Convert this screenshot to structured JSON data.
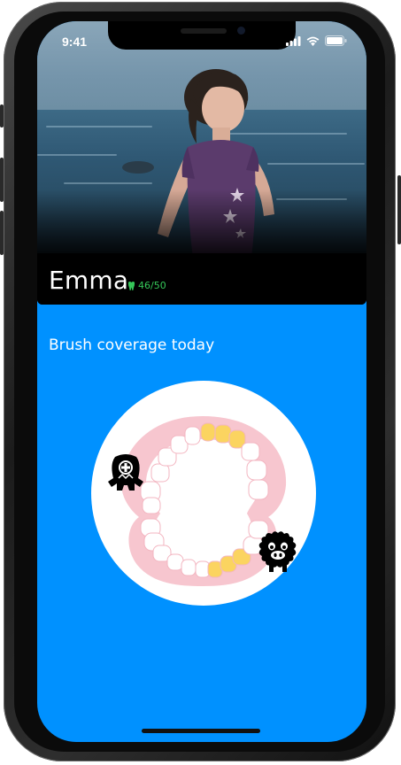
{
  "status_bar": {
    "time": "9:41"
  },
  "profile": {
    "name": "Emma",
    "score": "46/50",
    "score_color": "#35c759"
  },
  "coverage": {
    "title": "Brush coverage today",
    "brushed_color": "#fbd460",
    "unbrushed_color": "#ffffff",
    "gum_color": "#f7c6cf"
  },
  "colors": {
    "screen_background": "#0091ff"
  },
  "icons": {
    "tooth": "tooth-icon",
    "monster_one": "one-eyed-monster-icon",
    "monster_two": "fluffy-monster-icon"
  }
}
